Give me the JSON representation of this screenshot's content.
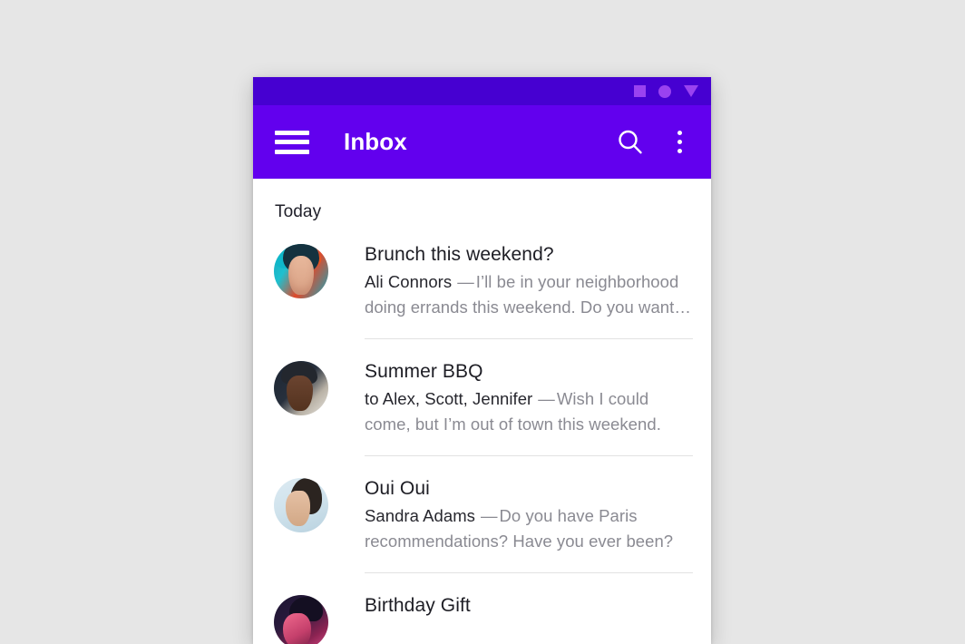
{
  "status_bar": {
    "icons": [
      "square-icon",
      "circle-icon",
      "triangle-down-icon"
    ],
    "background_color": "#4600d1",
    "icon_color": "#9a42f0"
  },
  "app_bar": {
    "title": "Inbox",
    "menu_icon": "hamburger-menu-icon",
    "search_icon": "search-icon",
    "overflow_icon": "more-vert-icon",
    "background_color": "#6200ee",
    "text_color": "#ffffff"
  },
  "list": {
    "section_label": "Today",
    "messages": [
      {
        "subject": "Brunch this weekend?",
        "sender": "Ali Connors",
        "dash": "—",
        "snippet": "I’ll be in your neighborhood doing errands this weekend. Do you want…",
        "avatar": "avatar-ali-connors"
      },
      {
        "subject": "Summer BBQ",
        "sender": "to Alex, Scott, Jennifer",
        "dash": "—",
        "snippet": "Wish I could come, but I’m out of town this weekend.",
        "avatar": "avatar-scott"
      },
      {
        "subject": "Oui Oui",
        "sender": "Sandra Adams",
        "dash": "—",
        "snippet": "Do you have Paris recommendations? Have you ever been?",
        "avatar": "avatar-sandra-adams"
      },
      {
        "subject": "Birthday Gift",
        "sender": "",
        "dash": "",
        "snippet": "",
        "avatar": "avatar-birthday"
      }
    ]
  },
  "page": {
    "background_color": "#e6e6e6"
  }
}
